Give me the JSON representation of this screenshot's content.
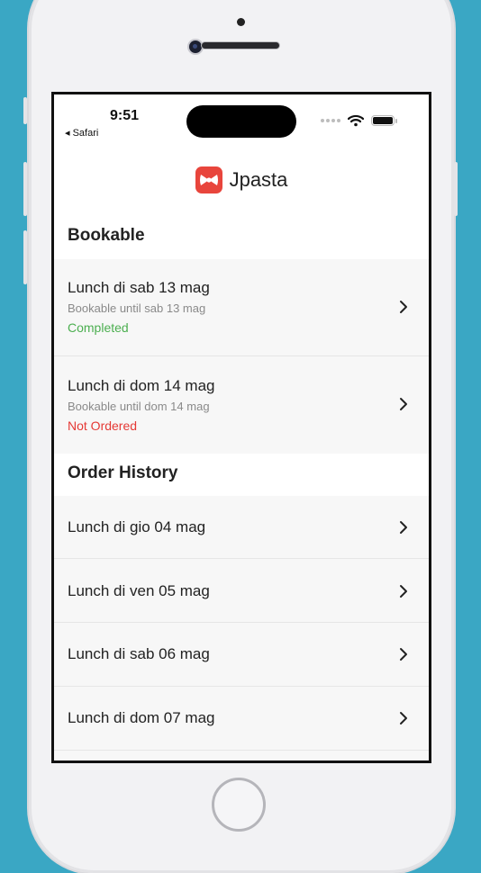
{
  "status_bar": {
    "time": "9:51",
    "back_label": "◂ Safari"
  },
  "app": {
    "name": "Jpasta",
    "brand_color": "#e8453c"
  },
  "sections": [
    {
      "title": "Bookable",
      "items": [
        {
          "title": "Lunch di sab 13 mag",
          "subtitle": "Bookable until sab 13 mag",
          "status": "Completed",
          "status_color": "#4caf50"
        },
        {
          "title": "Lunch di dom 14 mag",
          "subtitle": "Bookable until dom 14 mag",
          "status": "Not Ordered",
          "status_color": "#e53935"
        }
      ]
    },
    {
      "title": "Order History",
      "items": [
        {
          "title": "Lunch di gio 04 mag"
        },
        {
          "title": "Lunch di ven 05 mag"
        },
        {
          "title": "Lunch di sab 06 mag"
        },
        {
          "title": "Lunch di dom 07 mag"
        }
      ]
    }
  ]
}
